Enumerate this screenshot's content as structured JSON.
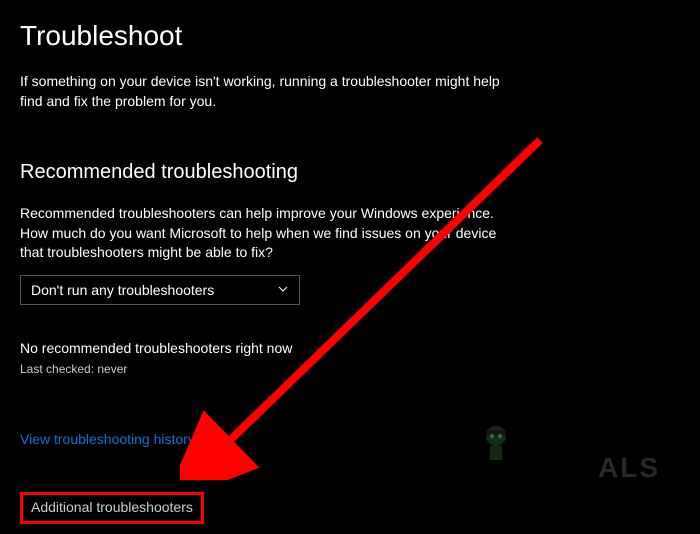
{
  "page": {
    "title": "Troubleshoot",
    "description": "If something on your device isn't working, running a troubleshooter might help find and fix the problem for you."
  },
  "recommended": {
    "title": "Recommended troubleshooting",
    "description": "Recommended troubleshooters can help improve your Windows experience. How much do you want Microsoft to help when we find issues on your device that troubleshooters might be able to fix?",
    "selected_option": "Don't run any troubleshooters",
    "status": "No recommended troubleshooters right now",
    "last_checked": "Last checked: never"
  },
  "links": {
    "history": "View troubleshooting history",
    "additional": "Additional troubleshooters"
  },
  "watermark": {
    "text": "ALS"
  }
}
